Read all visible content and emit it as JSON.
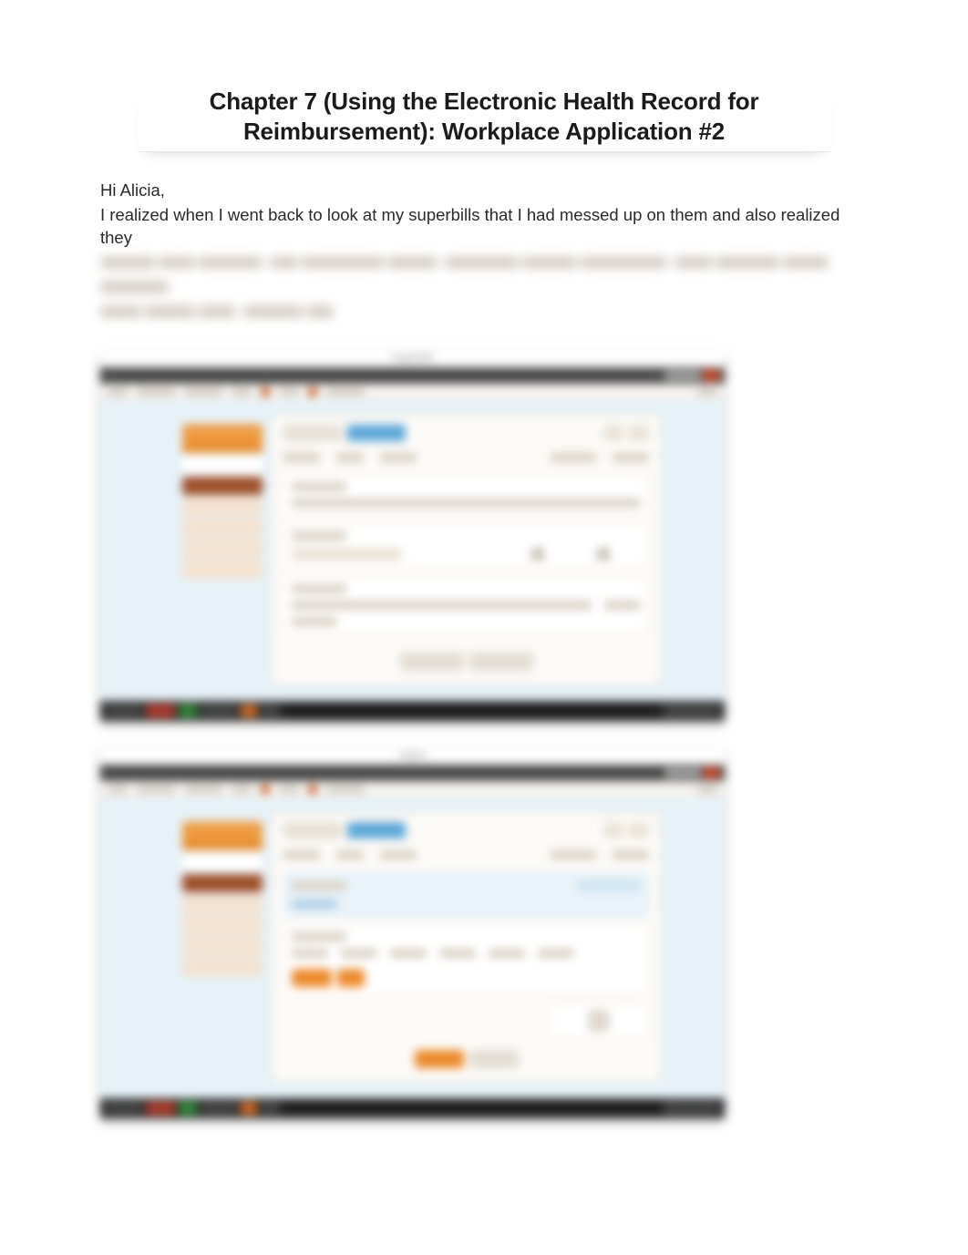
{
  "title": "Chapter 7 (Using the Electronic Health Record for Reimbursement): Workplace Application #2",
  "greeting": "Hi Alicia,",
  "paragraph_line1": "I realized when I went back to look at my superbills that I had messed up on them and also realized they",
  "screenshots": [
    {
      "label": "Superbill"
    },
    {
      "label": "Claim"
    }
  ]
}
